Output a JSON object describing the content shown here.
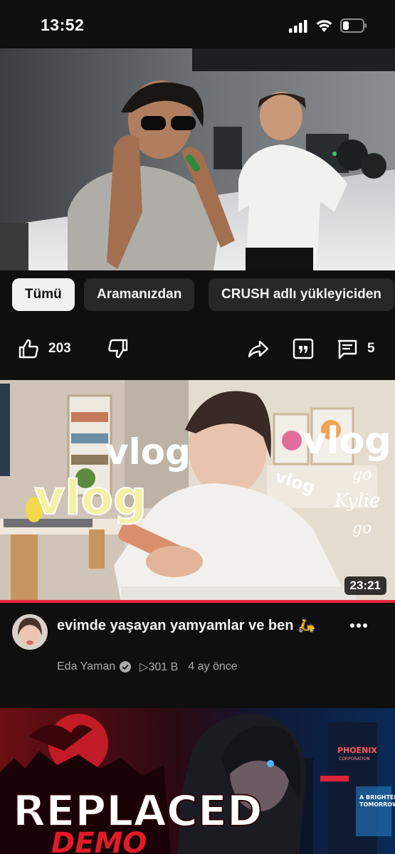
{
  "status_bar": {
    "time": "13:52"
  },
  "chips": [
    {
      "label": "Tümü",
      "active": true
    },
    {
      "label": "Aramanızdan",
      "active": false
    },
    {
      "label": "CRUSH adlı yükleyiciden",
      "active": false
    }
  ],
  "actions": {
    "likes": "203",
    "comments": "5"
  },
  "video1": {
    "title": "evimde yaşayan yamyamlar ve ben 🛵",
    "channel": "Eda Yaman",
    "views": "▷301 B",
    "age": "4 ay önce",
    "duration": "23:21",
    "overlay_texts": [
      "vlog",
      "vlog",
      "vlog",
      "vlog",
      "go",
      "Kylie",
      "go"
    ]
  },
  "video2": {
    "thumb_title": "REPLACED",
    "thumb_subtitle": "DEMO",
    "sign_brand": "PHOENIX",
    "sign_brand_sub": "CORPORATION",
    "billboard_line1": "A BRIGHTER",
    "billboard_line2": "TOMORROW"
  },
  "colors": {
    "background": "#0f0f0f",
    "chip": "#272727",
    "progress": "#e8263d"
  }
}
